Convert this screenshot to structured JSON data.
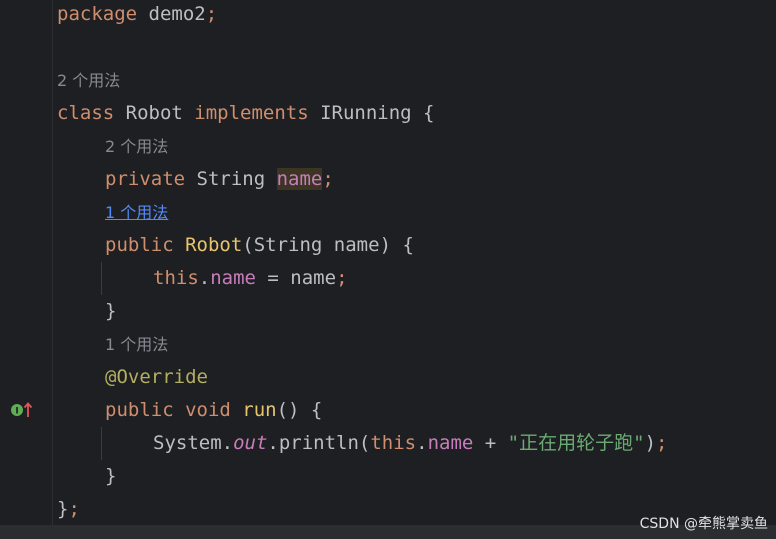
{
  "editor": {
    "line1": {
      "kw": "package",
      "rest": " demo2",
      "semi": ";"
    },
    "hint_class": "2 个用法",
    "line_class": {
      "kw": "class",
      "name": " Robot ",
      "kw2": "implements",
      "rest": " IRunning {"
    },
    "hint_field": "2 个用法",
    "line_field": {
      "kw": "private",
      "type": " String ",
      "field": "name",
      "semi": ";"
    },
    "hint_ctor": "1 个用法",
    "line_ctor": {
      "kw": "public",
      "name": "Robot",
      "rest": "(String name) {"
    },
    "line_assign": {
      "kw": "this",
      "dot": ".",
      "field": "name",
      "rest": " = name",
      "semi": ";"
    },
    "close1": "}",
    "hint_run": "1 个用法",
    "annotation": "@Override",
    "line_run": {
      "kw": "public",
      "kw2": " void ",
      "name": "run",
      "rest": "() {"
    },
    "line_print": {
      "sys": "System.",
      "out": "out",
      "mid": ".println(",
      "kw": "this",
      "dot": ".",
      "field": "name",
      "plus": " + ",
      "str": "\"正在用轮子跑\"",
      "end": ")",
      "semi": ";"
    },
    "close2": "}",
    "close3": "}",
    "semi_end": ";"
  },
  "watermark": "CSDN @牵熊掌卖鱼",
  "icons": {
    "gutter": "implements-method-icon"
  },
  "colors": {
    "background": "#1e1f22",
    "keyword": "#cf8e6d",
    "string": "#6aab73",
    "field": "#c77dbb"
  }
}
